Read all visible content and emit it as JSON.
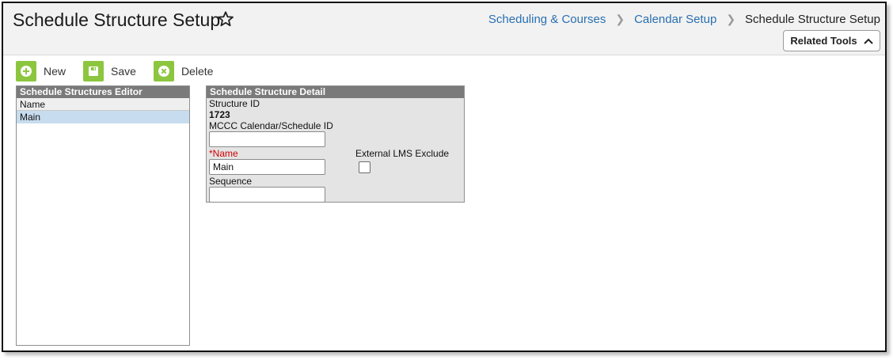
{
  "header": {
    "title": "Schedule Structure Setup",
    "breadcrumb": [
      "Scheduling & Courses",
      "Calendar Setup",
      "Schedule Structure Setup"
    ],
    "related_tools_label": "Related Tools"
  },
  "toolbar": {
    "new_label": "New",
    "save_label": "Save",
    "delete_label": "Delete"
  },
  "editor": {
    "title": "Schedule Structures Editor",
    "column_header": "Name",
    "rows": [
      "Main"
    ]
  },
  "detail": {
    "title": "Schedule Structure Detail",
    "structure_id_label": "Structure ID",
    "structure_id_value": "1723",
    "mccc_label": "MCCC Calendar/Schedule ID",
    "mccc_value": "",
    "name_label": "*Name",
    "name_value": "Main",
    "external_lms_label": "External LMS Exclude",
    "external_lms_checked": false,
    "sequence_label": "Sequence",
    "sequence_value": ""
  },
  "colors": {
    "accent_green": "#8cc63f",
    "link_blue": "#2a6fb0",
    "required_red": "#d00000",
    "panel_header": "#7a7a7a",
    "selected_row": "#c7dcee"
  },
  "icons": {
    "favorite": "star-icon",
    "new": "plus-circle-icon",
    "save": "floppy-disk-icon",
    "delete": "x-circle-icon",
    "related_tools": "chevron-up-icon",
    "breadcrumb_sep": "chevron-right-icon"
  }
}
